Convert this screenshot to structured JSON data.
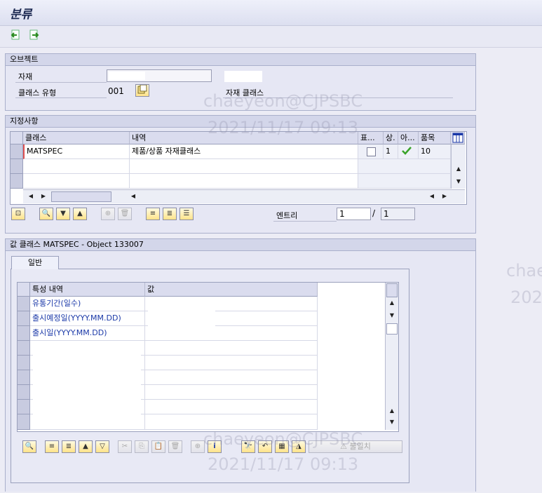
{
  "window": {
    "title": "분류"
  },
  "object_group": {
    "title": "오브젝트",
    "material_label": "자재",
    "class_type_label": "클래스 유형",
    "class_type_value": "001",
    "material_class_label": "자재 클래스"
  },
  "assignment_group": {
    "title": "지정사항",
    "columns": [
      "클래스",
      "내역",
      "표...",
      "상.",
      "아...",
      "품목"
    ],
    "rows": [
      {
        "class": "MATSPEC",
        "desc": "제품/상품 자재클래스",
        "standard": "",
        "status": "1",
        "item": "10"
      }
    ],
    "entry_label": "엔트리",
    "entry_value": "1",
    "entry_sep": "/",
    "entry_total": "1"
  },
  "values_group": {
    "title": "값 클래스 MATSPEC - Object 133007",
    "tab_label": "일반",
    "columns": [
      "특성 내역",
      "값"
    ],
    "rows": [
      "유통기간(일수)",
      "출시예정일(YYYY.MM.DD)",
      "출시일(YYYY.MM.DD)"
    ],
    "inconsistent_label": "불일치"
  },
  "watermark": {
    "user": "chaeyeon@CJPSBC",
    "datetime": "2021/11/17 09:13",
    "partial_user": "chae",
    "partial_year": "202"
  },
  "colors": {
    "accent": "#1b39a8",
    "check": "#3aa32a"
  }
}
